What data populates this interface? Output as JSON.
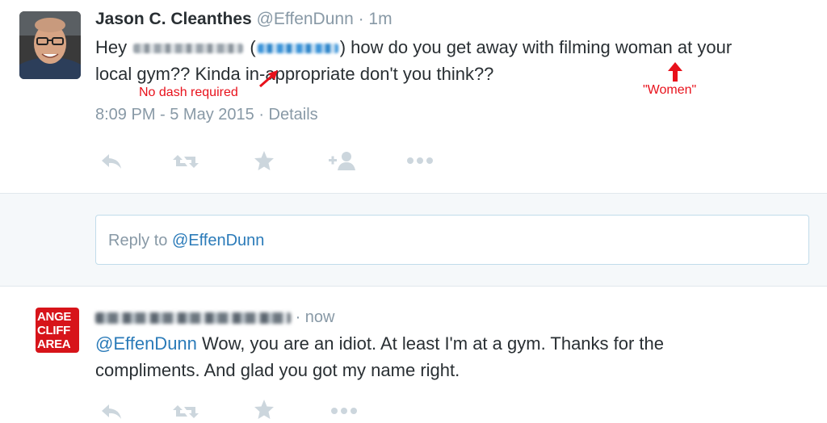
{
  "tweet1": {
    "name": "Jason C. Cleanthes",
    "handle": "@EffenDunn",
    "time": "· 1m",
    "text_hey": "Hey",
    "text_open": "(",
    "text_mid": ") how do you get away with filming woman at your",
    "text_line2_pre": "local gym?? Kinda in",
    "text_line2_post": "-appropriate don't you think??",
    "timestamp": "8:09 PM - 5 May 2015 · Details",
    "annotations": {
      "dash": "No dash required",
      "women": "\"Women\"",
      "color": "#e8111b"
    }
  },
  "actions": {
    "reply_icon": "reply-icon",
    "retweet_icon": "retweet-icon",
    "favorite_icon": "star-icon",
    "follow_icon": "follow-icon",
    "more_icon": "more-icon"
  },
  "reply_box": {
    "prefix": "Reply to ",
    "mention": "@EffenDunn"
  },
  "tweet2": {
    "avatar_lines": [
      "ANGE",
      "CLIFF",
      "AREA"
    ],
    "time": "· now",
    "mention": "@EffenDunn",
    "text_line1": " Wow, you are an idiot. At least I'm at a gym. Thanks for the",
    "text_line2": "compliments. And glad you got my name right."
  },
  "colors": {
    "link": "#2b7bb9",
    "muted": "#8899a6",
    "icon": "#ccd6dd",
    "panel": "#f5f8fa"
  }
}
